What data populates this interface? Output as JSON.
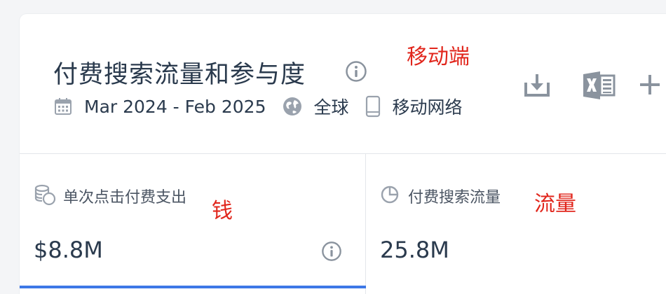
{
  "header": {
    "title": "付费搜索流量和参与度",
    "date_range": "Mar 2024 - Feb 2025",
    "region": "全球",
    "device": "移动网络",
    "annotation": "移动端"
  },
  "toolbar": {
    "icons": [
      "download-icon",
      "excel-icon",
      "add-icon"
    ]
  },
  "metrics": [
    {
      "label": "单次点击付费支出",
      "value": "$8.8M",
      "annotation": "钱",
      "icon": "coins-icon"
    },
    {
      "label": "付费搜索流量",
      "value": "25.8M",
      "annotation": "流量",
      "icon": "pie-chart-icon"
    }
  ],
  "colors": {
    "accent": "#3d78e6",
    "annotation": "#e1261c",
    "text": "#2a3a4d",
    "icon": "#8a939e"
  }
}
